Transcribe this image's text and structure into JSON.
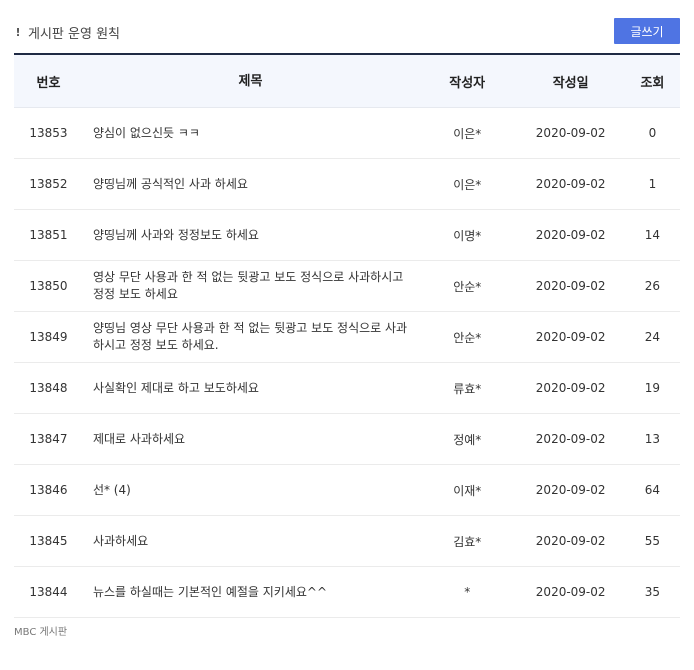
{
  "header": {
    "notice_icon": "!",
    "notice_label": "게시판 운영 원칙",
    "write_button": "글쓰기",
    "accent_color": "#4f74e3"
  },
  "table": {
    "columns": {
      "no": "번호",
      "title": "제목",
      "author": "작성자",
      "date": "작성일",
      "views": "조회"
    },
    "rows": [
      {
        "no": "13853",
        "title": "양심이 없으신듯 ㅋㅋ",
        "author": "이은*",
        "date": "2020-09-02",
        "views": "0"
      },
      {
        "no": "13852",
        "title": "양띵님께 공식적인 사과 하세요",
        "author": "이은*",
        "date": "2020-09-02",
        "views": "1"
      },
      {
        "no": "13851",
        "title": "양띵님께 사과와 정정보도 하세요",
        "author": "이명*",
        "date": "2020-09-02",
        "views": "14"
      },
      {
        "no": "13850",
        "title": "영상 무단 사용과 한 적 없는 뒷광고 보도 정식으로 사과하시고 정정 보도 하세요",
        "author": "안순*",
        "date": "2020-09-02",
        "views": "26"
      },
      {
        "no": "13849",
        "title": "양띵님 영상 무단 사용과 한 적 없는 뒷광고 보도 정식으로 사과하시고 정정 보도 하세요.",
        "author": "안순*",
        "date": "2020-09-02",
        "views": "24"
      },
      {
        "no": "13848",
        "title": "사실확인 제대로 하고 보도하세요",
        "author": "류효*",
        "date": "2020-09-02",
        "views": "19"
      },
      {
        "no": "13847",
        "title": "제대로 사과하세요",
        "author": "정예*",
        "date": "2020-09-02",
        "views": "13"
      },
      {
        "no": "13846",
        "title": "선* (4)",
        "author": "이재*",
        "date": "2020-09-02",
        "views": "64"
      },
      {
        "no": "13845",
        "title": "사과하세요",
        "author": "김효*",
        "date": "2020-09-02",
        "views": "55"
      },
      {
        "no": "13844",
        "title": "뉴스를 하실때는 기본적인 예절을 지키세요^^",
        "author": "*",
        "date": "2020-09-02",
        "views": "35"
      }
    ]
  },
  "footer": {
    "label": "MBC 게시판"
  }
}
